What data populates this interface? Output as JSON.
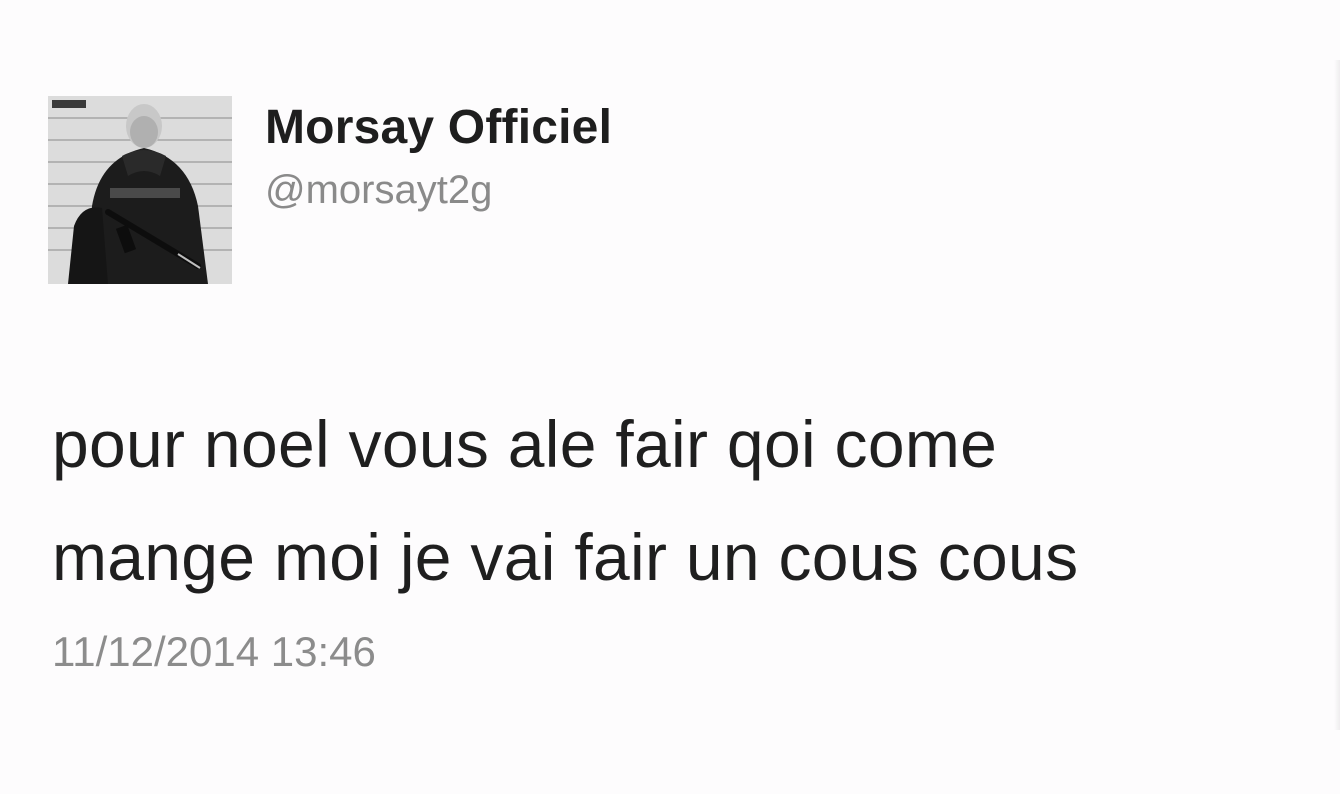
{
  "tweet": {
    "author": {
      "display_name": "Morsay Officiel",
      "handle": "@morsayt2g",
      "avatar_icon": "profile-photo-avatar"
    },
    "text_lines": [
      "pour noel vous ale fair qoi come",
      "mange moi je vai fair un cous cous"
    ],
    "timestamp": "11/12/2014 13:46"
  },
  "colors": {
    "background": "#fdfcfd",
    "name": "#1e1e1e",
    "muted": "#8a8a8a",
    "text": "#1f1f1f"
  }
}
